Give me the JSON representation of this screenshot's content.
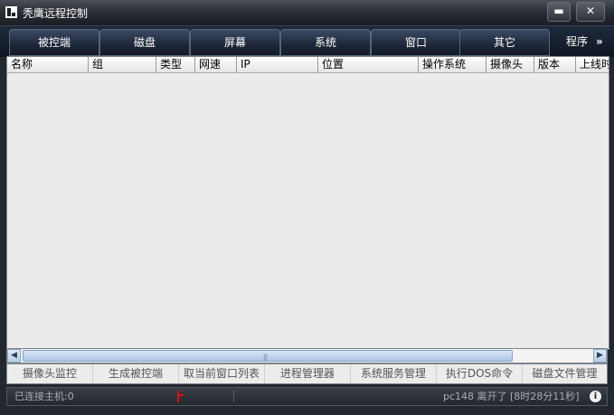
{
  "window": {
    "title": "秃鹰远程控制",
    "min_glyph": "▬",
    "close_glyph": "✕"
  },
  "tabs": [
    "被控端",
    "磁盘",
    "屏幕",
    "系统",
    "窗口",
    "其它"
  ],
  "more_tab": {
    "label": "程序",
    "arrow": "»"
  },
  "columns": [
    "名称",
    "组",
    "类型",
    "网速",
    "IP",
    "位置",
    "操作系统",
    "摄像头",
    "版本",
    "上线时"
  ],
  "rows": [],
  "scrollbar": {
    "left_arrow": "◀",
    "right_arrow": "▶",
    "grip": "|||"
  },
  "actions": [
    "摄像头监控",
    "生成被控端",
    "取当前窗口列表",
    "进程管理器",
    "系统服务管理",
    "执行DOS命令",
    "磁盘文件管理"
  ],
  "status": {
    "connected": "已连接主机:0",
    "event": "pc148 离开了 [8时28分11秒]",
    "info_glyph": "i"
  },
  "colors": {
    "flag": "#e01010",
    "accent": "#1d2738"
  }
}
